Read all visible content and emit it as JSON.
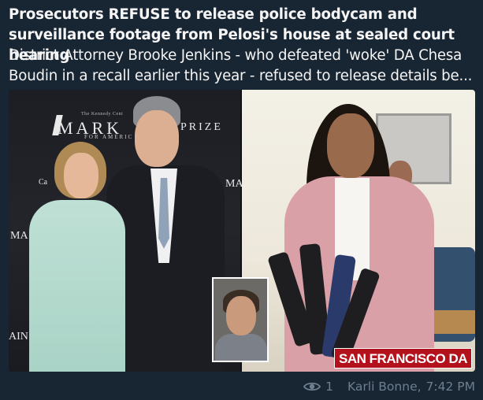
{
  "post": {
    "title": "Prosecutors REFUSE to release police bodycam and surveillance footage from Pelosi's house at sealed court hearing",
    "description_line1": "District Attorney Brooke Jenkins - who defeated 'woke' DA Chesa",
    "description_line2": "Boudin in a recall earlier this year - refused to release details be..."
  },
  "media": {
    "backdrop": {
      "small": "The Kennedy Cent",
      "mark": "MARK",
      "for": "FOR AMERIC",
      "prize": "PRIZE",
      "ma1": "MA",
      "ma2": "MA",
      "ain": "AIN",
      "c": "Ca"
    },
    "brand_tag": "SAN FRANCISCO DA"
  },
  "footer": {
    "views": "1",
    "author": "Karli Bonne,",
    "time": "7:42 PM"
  },
  "colors": {
    "background": "#182533",
    "text": "#f5f5f5",
    "meta": "#6d7f8f",
    "brand_red": "#b3121c"
  }
}
